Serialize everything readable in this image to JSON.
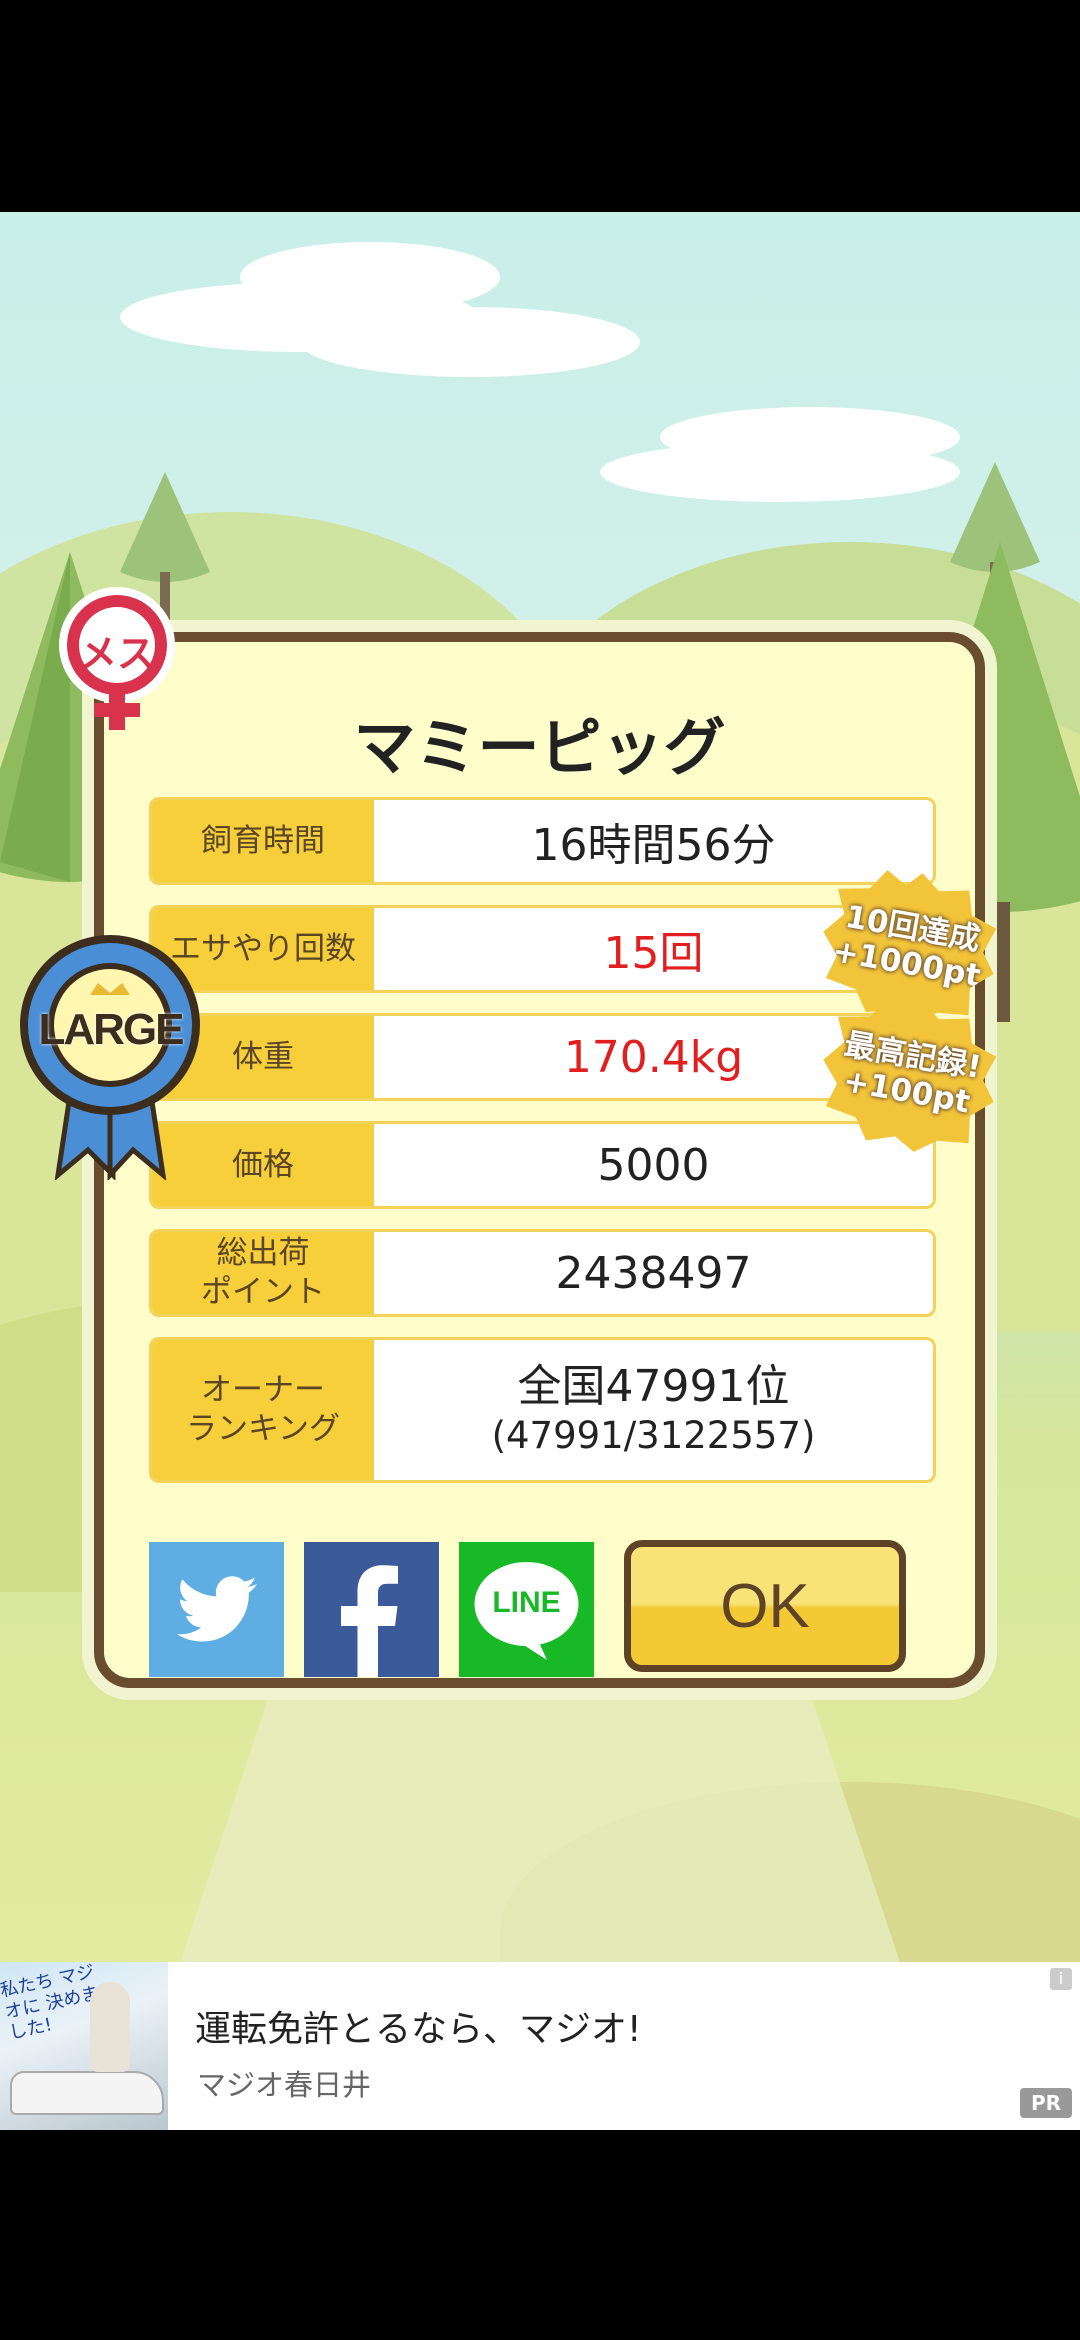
{
  "pig": {
    "name": "マミーピッグ",
    "gender_badge": "メス",
    "size_badge": "LARGE"
  },
  "stats": [
    {
      "label": "飼育時間",
      "value": "16時間56分",
      "highlight": false
    },
    {
      "label": "エサやり回数",
      "value": "15回",
      "highlight": true
    },
    {
      "label": "体重",
      "value": "170.4kg",
      "highlight": true
    },
    {
      "label": "価格",
      "value": "5000",
      "highlight": false
    },
    {
      "label": "総出荷\nポイント",
      "value": "2438497",
      "highlight": false
    }
  ],
  "ranking": {
    "label": "オーナー\nランキング",
    "value_main": "全国47991位",
    "value_sub": "(47991/3122557)"
  },
  "bonus_badges": [
    {
      "line1": "10回達成",
      "line2": "+1000pt"
    },
    {
      "line1": "最高記録!",
      "line2": "+100pt"
    }
  ],
  "share": {
    "twitter_icon": "twitter-bird-icon",
    "facebook_icon": "facebook-f-icon",
    "line_label": "LINE"
  },
  "ok_label": "OK",
  "ad": {
    "title": "運転免許とるなら、マジオ!",
    "sponsor": "マジオ春日井",
    "pr_label": "PR",
    "info_label": "i",
    "thumb_text": "私たち マジオに 決めました!"
  },
  "colors": {
    "highlight_red": "#e11f1f",
    "label_yellow": "#f6cf3a",
    "frame_brown": "#6a4d2e"
  }
}
